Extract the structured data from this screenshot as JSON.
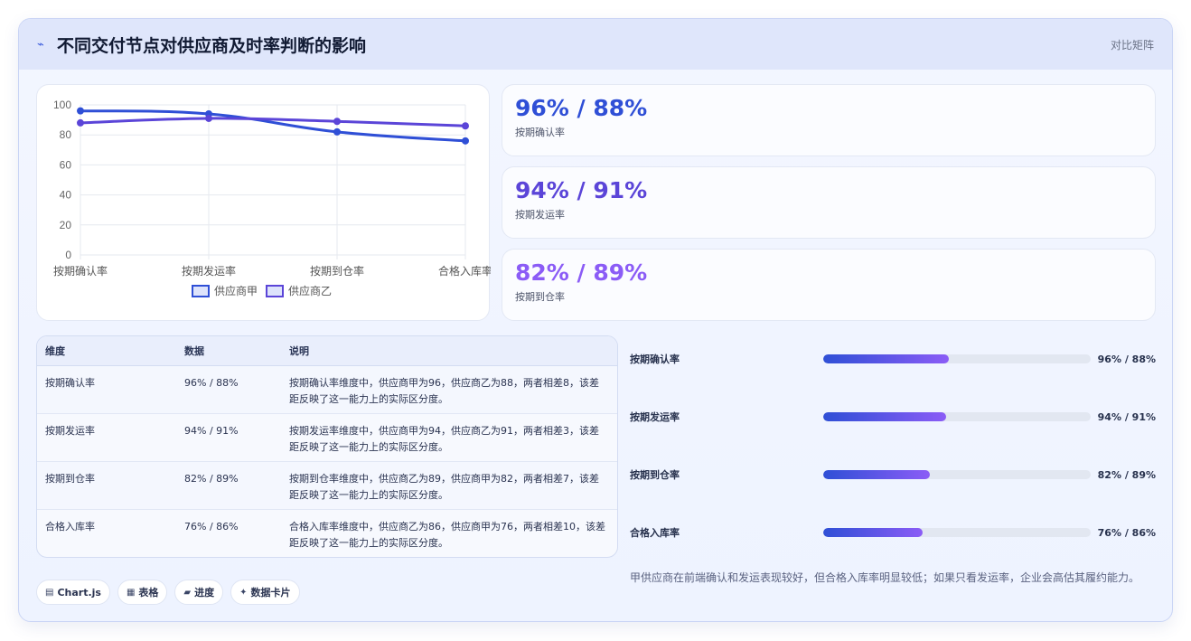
{
  "header": {
    "icon": "pulse-icon",
    "title": "不同交付节点对供应商及时率判断的影响",
    "tag": "对比矩阵"
  },
  "chart_data": {
    "type": "line",
    "categories": [
      "按期确认率",
      "按期发运率",
      "按期到仓率",
      "合格入库率"
    ],
    "series": [
      {
        "name": "供应商甲",
        "values": [
          96,
          94,
          82,
          76
        ],
        "color": "#2f4fd6"
      },
      {
        "name": "供应商乙",
        "values": [
          88,
          91,
          89,
          86
        ],
        "color": "#5b45d8"
      }
    ],
    "ylim": [
      0,
      100
    ],
    "yticks": [
      0,
      20,
      40,
      60,
      80,
      100
    ],
    "grid": true,
    "legend": "bottom"
  },
  "metrics": [
    {
      "value": "96% / 88%",
      "label": "按期确认率",
      "color": "#2f4fd6"
    },
    {
      "value": "94% / 91%",
      "label": "按期发运率",
      "color": "#5b45d8"
    },
    {
      "value": "82% / 89%",
      "label": "按期到仓率",
      "color": "#8b5cf6"
    }
  ],
  "table": {
    "headers": [
      "维度",
      "数据",
      "说明"
    ],
    "rows": [
      {
        "dim": "按期确认率",
        "data": "96% / 88%",
        "desc": "按期确认率维度中，供应商甲为96，供应商乙为88，两者相差8，该差距反映了这一能力上的实际区分度。"
      },
      {
        "dim": "按期发运率",
        "data": "94% / 91%",
        "desc": "按期发运率维度中，供应商甲为94，供应商乙为91，两者相差3，该差距反映了这一能力上的实际区分度。"
      },
      {
        "dim": "按期到仓率",
        "data": "82% / 89%",
        "desc": "按期到仓率维度中，供应商乙为89，供应商甲为82，两者相差7，该差距反映了这一能力上的实际区分度。"
      },
      {
        "dim": "合格入库率",
        "data": "76% / 86%",
        "desc": "合格入库率维度中，供应商乙为86，供应商甲为76，两者相差10，该差距反映了这一能力上的实际区分度。"
      }
    ]
  },
  "progress": [
    {
      "label": "按期确认率",
      "value": "96% / 88%",
      "fill": 0.47
    },
    {
      "label": "按期发运率",
      "value": "94% / 91%",
      "fill": 0.46
    },
    {
      "label": "按期到仓率",
      "value": "82% / 89%",
      "fill": 0.4
    },
    {
      "label": "合格入库率",
      "value": "76% / 86%",
      "fill": 0.37
    }
  ],
  "chips": [
    {
      "icon": "chart-icon",
      "glyph": "▤",
      "label": "Chart.js"
    },
    {
      "icon": "table-icon",
      "glyph": "▦",
      "label": "表格"
    },
    {
      "icon": "progress-icon",
      "glyph": "▰",
      "label": "进度"
    },
    {
      "icon": "card-icon",
      "glyph": "✦",
      "label": "数据卡片"
    }
  ],
  "note": "甲供应商在前端确认和发运表现较好，但合格入库率明显较低；如果只看发运率，企业会高估其履约能力。"
}
